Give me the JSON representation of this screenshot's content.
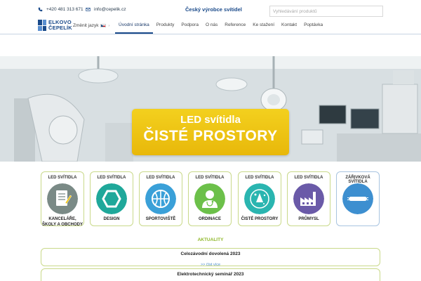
{
  "header": {
    "phone": "+420 481 313 671",
    "email": "info@cepelik.cz",
    "tagline": "Český výrobce svítidel",
    "search_placeholder": "Vyhledávání produktů"
  },
  "logo": {
    "line1": "ELKOVO",
    "line2": "ČEPELÍK"
  },
  "lang": {
    "label": "Změnit jazyk"
  },
  "nav": {
    "items": [
      {
        "label": "Úvodní stránka",
        "active": true
      },
      {
        "label": "Produkty"
      },
      {
        "label": "Podpora"
      },
      {
        "label": "O nás"
      },
      {
        "label": "Reference"
      },
      {
        "label": "Ke stažení"
      },
      {
        "label": "Kontakt"
      },
      {
        "label": "Poptávka"
      }
    ]
  },
  "hero": {
    "line1": "LED svítidla",
    "line2": "ČISTÉ PROSTORY"
  },
  "categories": [
    {
      "top": "LED SVÍTIDLA",
      "bottom": "KANCELÁŘE,\nŠKOLY A OBCHODY",
      "icon": "notepad-icon",
      "color": "#7a8a86"
    },
    {
      "top": "LED SVÍTIDLA",
      "bottom": "DESIGN",
      "icon": "hexagon-icon",
      "color": "#1fa89a"
    },
    {
      "top": "LED SVÍTIDLA",
      "bottom": "SPORTOVIŠTĚ",
      "icon": "basketball-icon",
      "color": "#3aa0d8"
    },
    {
      "top": "LED SVÍTIDLA",
      "bottom": "ORDINACE",
      "icon": "doctor-icon",
      "color": "#6cc04a"
    },
    {
      "top": "LED SVÍTIDLA",
      "bottom": "ČISTÉ PROSTORY",
      "icon": "clean-room-icon",
      "color": "#2ab5b0"
    },
    {
      "top": "LED SVÍTIDLA",
      "bottom": "PRŮMYSL",
      "icon": "factory-icon",
      "color": "#6a5aa8"
    },
    {
      "top": "ZÁŘIVKOVÁ SVÍTIDLA",
      "bottom": "",
      "icon": "fluorescent-tube-icon",
      "color": "#3d8fd0"
    }
  ],
  "news": {
    "title": "AKTUALITY",
    "items": [
      {
        "heading": "Celozávodní dovolená 2023",
        "link": ">> číst více"
      },
      {
        "heading": "Elektrotechnický seminář 2023",
        "link": ""
      }
    ]
  }
}
